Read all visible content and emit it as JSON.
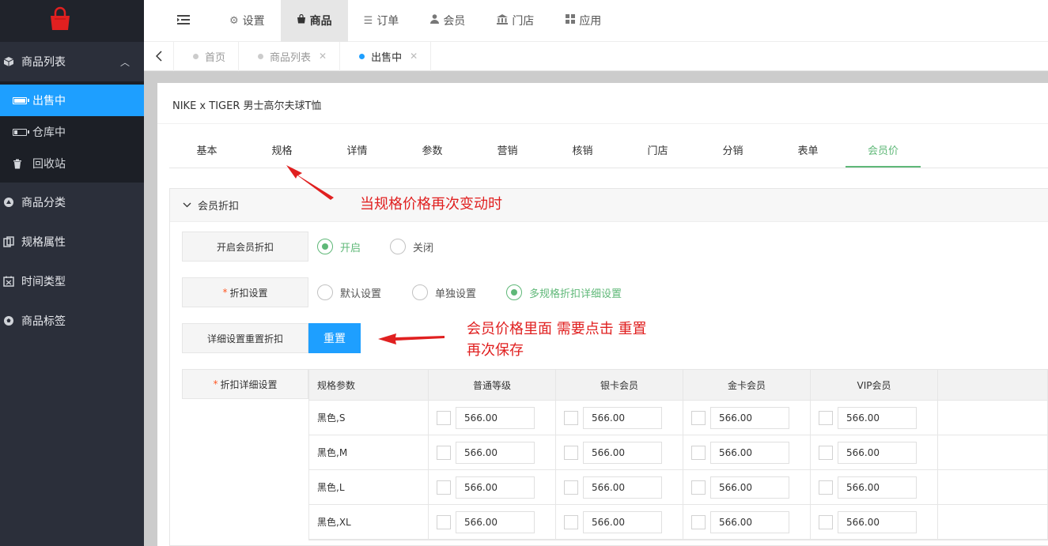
{
  "sidebar": {
    "groups": [
      {
        "label": "商品列表",
        "icon": "cube-icon"
      },
      {
        "label": "商品分类",
        "icon": "circle-icon"
      },
      {
        "label": "规格属性",
        "icon": "copy-icon"
      },
      {
        "label": "时间类型",
        "icon": "calendar-icon"
      },
      {
        "label": "商品标签",
        "icon": "soccer-icon"
      }
    ],
    "subitems": [
      {
        "label": "出售中",
        "icon": "battery-full-icon"
      },
      {
        "label": "仓库中",
        "icon": "battery-low-icon"
      },
      {
        "label": "回收站",
        "icon": "trash-icon"
      }
    ]
  },
  "topnav": {
    "items": [
      {
        "label": "设置",
        "icon": "gears-icon"
      },
      {
        "label": "商品",
        "icon": "bag-icon"
      },
      {
        "label": "订单",
        "icon": "list-icon"
      },
      {
        "label": "会员",
        "icon": "user-icon"
      },
      {
        "label": "门店",
        "icon": "bank-icon"
      },
      {
        "label": "应用",
        "icon": "grid-icon"
      }
    ],
    "active": "商品"
  },
  "page_tabs": [
    {
      "label": "首页"
    },
    {
      "label": "商品列表"
    },
    {
      "label": "出售中"
    }
  ],
  "product_title": "NIKE x TIGER 男士高尔夫球T恤",
  "form_tabs": [
    "基本",
    "规格",
    "详情",
    "参数",
    "营销",
    "核销",
    "门店",
    "分销",
    "表单",
    "会员价"
  ],
  "section": {
    "title": "会员折扣",
    "enable_label": "开启会员折扣",
    "enable_on": "开启",
    "enable_off": "关闭",
    "discount_label": "折扣设置",
    "discount_options": [
      "默认设置",
      "单独设置",
      "多规格折扣详细设置"
    ],
    "reset_label": "详细设置重置折扣",
    "reset_button": "重置",
    "detail_label": "折扣详细设置"
  },
  "table": {
    "headers": [
      "规格参数",
      "普通等级",
      "银卡会员",
      "金卡会员",
      "VIP会员"
    ],
    "rows": [
      {
        "spec": "黑色,S",
        "prices": [
          "566.00",
          "566.00",
          "566.00",
          "566.00"
        ]
      },
      {
        "spec": "黑色,M",
        "prices": [
          "566.00",
          "566.00",
          "566.00",
          "566.00"
        ]
      },
      {
        "spec": "黑色,L",
        "prices": [
          "566.00",
          "566.00",
          "566.00",
          "566.00"
        ]
      },
      {
        "spec": "黑色,XL",
        "prices": [
          "566.00",
          "566.00",
          "566.00",
          "566.00"
        ]
      }
    ]
  },
  "annotations": {
    "note1": "当规格价格再次变动时",
    "note2_line1": "会员价格里面 需要点击 重置",
    "note2_line2": "再次保存"
  },
  "colors": {
    "sidebar_bg": "#2b2f3a",
    "active_blue": "#1e9fff",
    "active_green": "#5fb878",
    "annotation_red": "#e02020"
  }
}
